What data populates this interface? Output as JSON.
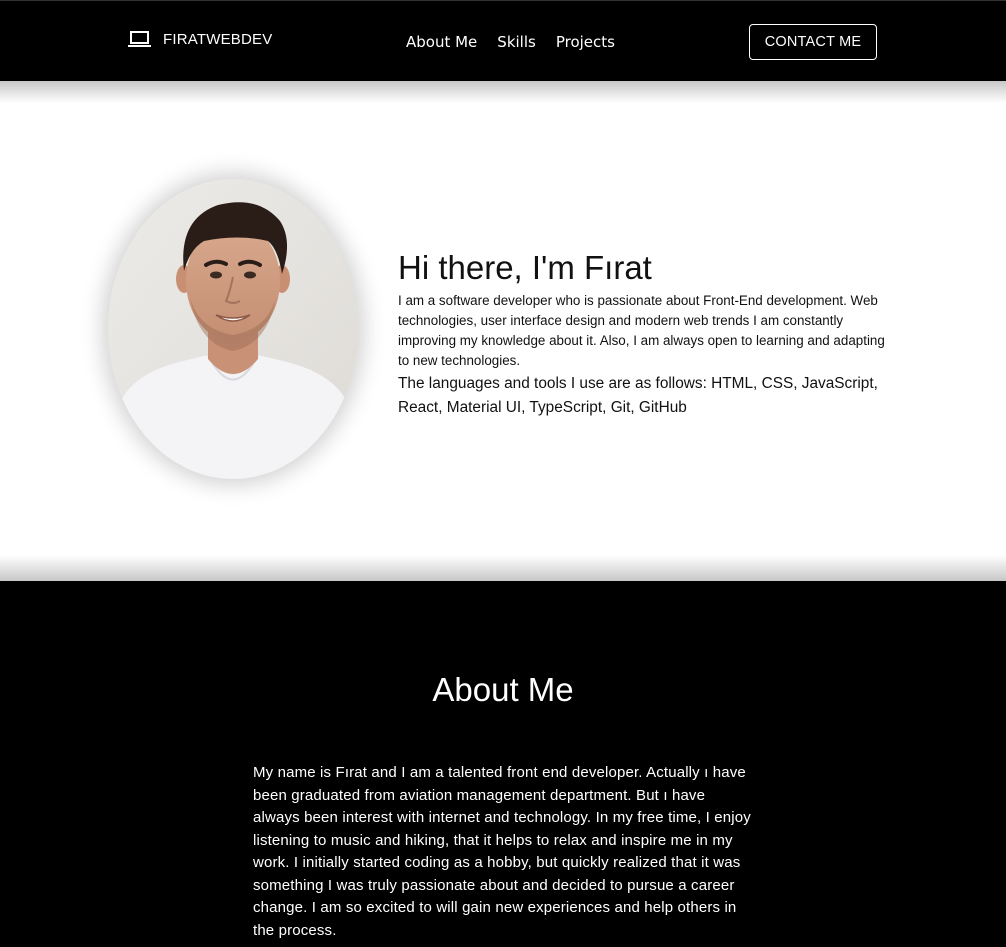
{
  "navbar": {
    "brand": "FIRATWEBDEV",
    "brand_icon": "laptop-icon",
    "links": [
      "About Me",
      "Skills",
      "Projects"
    ],
    "contact_label": "CONTACT ME"
  },
  "hero": {
    "title": "Hi there, I'm Fırat",
    "description": "I am a software developer who is passionate about Front-End development. Web technologies, user interface design and modern web trends I am constantly improving my knowledge about it. Also, I am always open to learning and adapting to new technologies.",
    "tools": "The languages and tools I use are as follows: HTML, CSS, JavaScript, React, Material UI, TypeScript, Git, GitHub"
  },
  "about": {
    "title": "About Me",
    "text": "My name is Fırat and I am a talented front end developer. Actually ı have been graduated from aviation management department. But ı have always been interest with internet and technology. In my free time, I enjoy listening to music and hiking, that it helps to relax and inspire me in my work. I initially started coding as a hobby, but quickly realized that it was something I was truly passionate about and decided to pursue a career change. I am so excited to will gain new experiences and help others in the process."
  },
  "colors": {
    "nav_bg": "#000000",
    "hero_bg": "#ffffff",
    "about_bg": "#000000",
    "text_light": "#ffffff",
    "text_dark": "#111111"
  }
}
